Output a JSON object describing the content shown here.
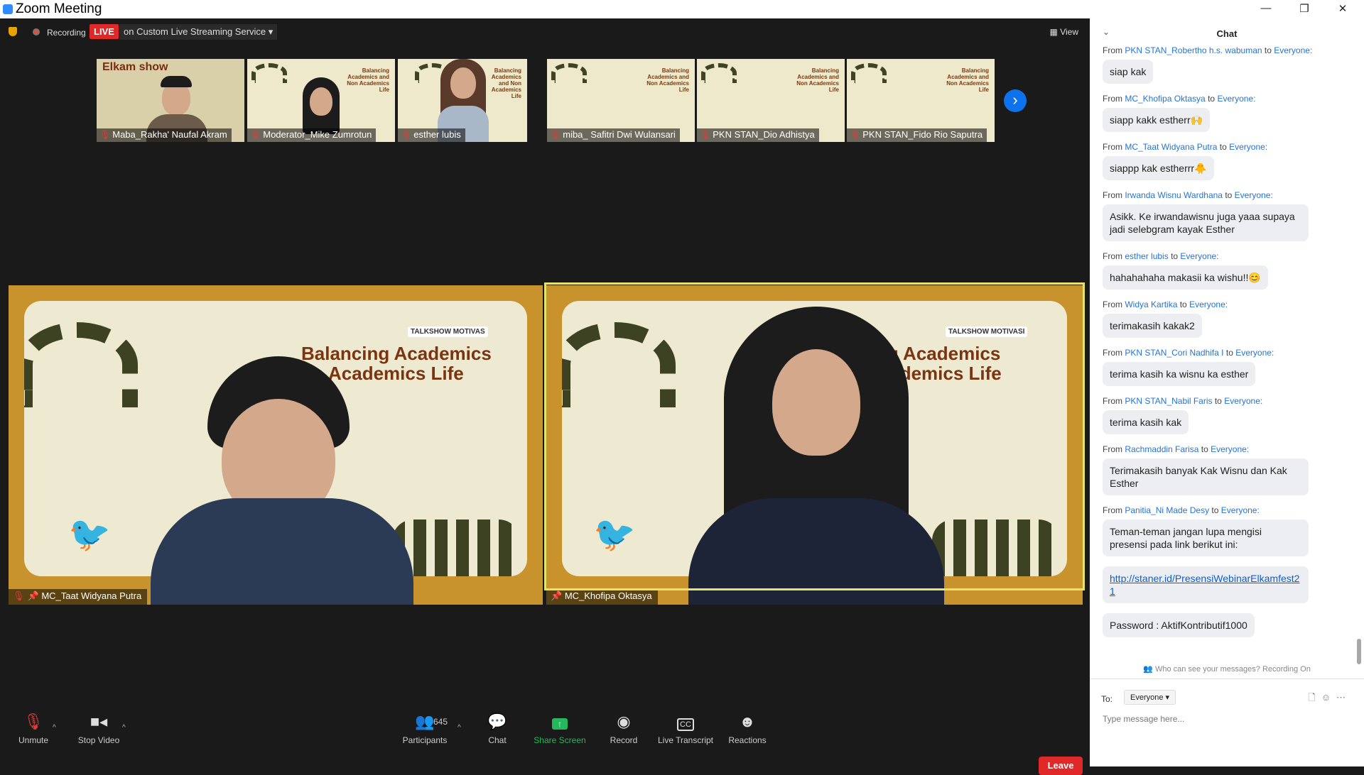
{
  "window": {
    "title": "Zoom Meeting",
    "controls": [
      "—",
      "❐",
      "✕"
    ]
  },
  "topbar": {
    "recording_label": "Recording",
    "live_label": "LIVE",
    "stream_label": "on Custom Live Streaming Service",
    "view_label": "View"
  },
  "thumbnails": [
    {
      "name": "Maba_Rakha' Naufal Akram",
      "overlay": "Elkam show"
    },
    {
      "name": "Moderator_Mike Zumrotun"
    },
    {
      "name": "esther lubis"
    },
    {
      "name": "miba_ Safitri Dwi Wulansari"
    },
    {
      "name": "PKN STAN_Dio Adhistya"
    },
    {
      "name": "PKN STAN_Fido Rio Saputra"
    }
  ],
  "thumb_headline": "Balancing Academics and Non Academics Life",
  "videos": [
    {
      "name": "MC_Taat Widyana Putra",
      "headline_1": "Balancing Academics",
      "headline_2": "on Academics Life",
      "badge": "TALKSHOW MOTIVAS"
    },
    {
      "name": "MC_Khofipa Oktasya",
      "headline_1": "ancing Academics",
      "headline_2": "on Academics Life",
      "badge": "TALKSHOW MOTIVASI"
    }
  ],
  "toolbar": {
    "unmute": "Unmute",
    "stop_video": "Stop Video",
    "participants": "Participants",
    "participants_count": "645",
    "chat": "Chat",
    "share_screen": "Share Screen",
    "record": "Record",
    "live_transcript": "Live Transcript",
    "reactions": "Reactions",
    "leave": "Leave"
  },
  "chat": {
    "title": "Chat",
    "messages": [
      {
        "from": "PKN STAN_Robertho h.s. wabuman",
        "to": "Everyone:",
        "text": "siap kak"
      },
      {
        "from": "MC_Khofipa Oktasya",
        "to": "Everyone:",
        "text": "siapp kakk estherr🙌"
      },
      {
        "from": "MC_Taat Widyana Putra",
        "to": "Everyone:",
        "text": "siappp kak estherrr🐥"
      },
      {
        "from": "Irwanda Wisnu Wardhana",
        "to": "Everyone:",
        "text": "Asikk. Ke irwandawisnu juga yaaa supaya jadi selebgram kayak Esther"
      },
      {
        "from": "esther lubis",
        "to": "Everyone:",
        "text": "hahahahaha makasii ka wishu!!😊"
      },
      {
        "from": "Widya Kartika",
        "to": "Everyone:",
        "text": "terimakasih kakak2"
      },
      {
        "from": "PKN STAN_Cori Nadhifa I",
        "to": "Everyone:",
        "text": "terima kasih ka wisnu ka esther"
      },
      {
        "from": "PKN STAN_Nabil Faris",
        "to": "Everyone:",
        "text": "terima kasih kak"
      },
      {
        "from": "Rachmaddin Farisa",
        "to": "Everyone:",
        "text": "Terimakasih banyak Kak Wisnu dan Kak Esther"
      },
      {
        "from": "Panitia_Ni Made Desy",
        "to": "Everyone:",
        "text": "Teman-teman jangan lupa mengisi presensi pada link berikut ini:",
        "extra": [
          "http://staner.id/PresensiWebinarElkamfest21",
          "Password : AktifKontributif1000"
        ]
      }
    ],
    "from_word": "From",
    "to_word": "to",
    "privacy_note": "Who can see your messages? Recording On",
    "to_label": "To:",
    "recipient": "Everyone",
    "input_placeholder": "Type message here..."
  }
}
